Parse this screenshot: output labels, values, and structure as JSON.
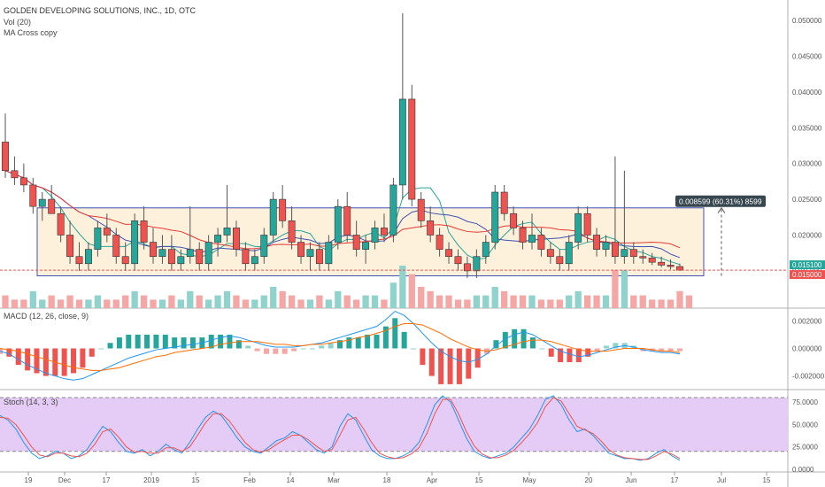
{
  "header": {
    "symbol": "GOLDEN DEVELOPING SOLUTIONS, INC., 1D, OTC",
    "vol_label": "Vol (20)",
    "ma_label": "MA Cross copy",
    "macd_label": "MACD (12, 26, close, 9)",
    "stoch_label": "Stoch (14, 3, 3)"
  },
  "colors": {
    "up": "#26a69a",
    "down": "#ef5350",
    "vol_up": "#8fd3cc",
    "vol_down": "#f4a7a5",
    "box_fill": "#fdf1dc",
    "box_stroke": "#3f51b5",
    "macd_line": "#2196f3",
    "signal_line": "#ff6d00",
    "stoch_bg": "#e5ccf6",
    "price_tag": "#26a69a",
    "price_tag2": "#ef5350",
    "measure_bg": "#37474f"
  },
  "chart_data": [
    {
      "type": "candlestick",
      "title": "GOLDEN DEVELOPING SOLUTIONS, INC., 1D, OTC",
      "x_ticks": [
        "19",
        "Dec",
        "17",
        "2019",
        "15",
        "Feb",
        "14",
        "Mar",
        "18",
        "Apr",
        "15",
        "May",
        "20",
        "Jun",
        "17",
        "Jul",
        "15"
      ],
      "y_ticks": [
        "0.050000",
        "0.045000",
        "0.040000",
        "0.035000",
        "0.030000",
        "0.025000",
        "0.020000",
        "0.015000"
      ],
      "ylim": [
        0.0135,
        0.051
      ],
      "price_tags": [
        "0.015100",
        "0.015000"
      ],
      "measure_label": "0.008599 (60.31%) 8599",
      "range_box": {
        "low": 0.0143,
        "high": 0.0238
      },
      "candles": [
        {
          "o": 0.033,
          "h": 0.037,
          "l": 0.028,
          "c": 0.029
        },
        {
          "o": 0.029,
          "h": 0.031,
          "l": 0.027,
          "c": 0.028
        },
        {
          "o": 0.028,
          "h": 0.03,
          "l": 0.026,
          "c": 0.027
        },
        {
          "o": 0.027,
          "h": 0.028,
          "l": 0.023,
          "c": 0.024
        },
        {
          "o": 0.024,
          "h": 0.026,
          "l": 0.022,
          "c": 0.025
        },
        {
          "o": 0.025,
          "h": 0.027,
          "l": 0.023,
          "c": 0.023
        },
        {
          "o": 0.023,
          "h": 0.024,
          "l": 0.019,
          "c": 0.02
        },
        {
          "o": 0.02,
          "h": 0.022,
          "l": 0.016,
          "c": 0.017
        },
        {
          "o": 0.017,
          "h": 0.019,
          "l": 0.015,
          "c": 0.016
        },
        {
          "o": 0.016,
          "h": 0.019,
          "l": 0.015,
          "c": 0.018
        },
        {
          "o": 0.018,
          "h": 0.022,
          "l": 0.017,
          "c": 0.021
        },
        {
          "o": 0.021,
          "h": 0.023,
          "l": 0.019,
          "c": 0.02
        },
        {
          "o": 0.02,
          "h": 0.021,
          "l": 0.016,
          "c": 0.017
        },
        {
          "o": 0.017,
          "h": 0.019,
          "l": 0.015,
          "c": 0.016
        },
        {
          "o": 0.016,
          "h": 0.023,
          "l": 0.015,
          "c": 0.022
        },
        {
          "o": 0.022,
          "h": 0.024,
          "l": 0.018,
          "c": 0.019
        },
        {
          "o": 0.019,
          "h": 0.021,
          "l": 0.016,
          "c": 0.017
        },
        {
          "o": 0.017,
          "h": 0.02,
          "l": 0.016,
          "c": 0.018
        },
        {
          "o": 0.018,
          "h": 0.02,
          "l": 0.015,
          "c": 0.016
        },
        {
          "o": 0.016,
          "h": 0.018,
          "l": 0.015,
          "c": 0.017
        },
        {
          "o": 0.017,
          "h": 0.024,
          "l": 0.016,
          "c": 0.018
        },
        {
          "o": 0.018,
          "h": 0.019,
          "l": 0.015,
          "c": 0.016
        },
        {
          "o": 0.016,
          "h": 0.02,
          "l": 0.015,
          "c": 0.019
        },
        {
          "o": 0.019,
          "h": 0.021,
          "l": 0.017,
          "c": 0.02
        },
        {
          "o": 0.02,
          "h": 0.027,
          "l": 0.019,
          "c": 0.021
        },
        {
          "o": 0.021,
          "h": 0.022,
          "l": 0.017,
          "c": 0.018
        },
        {
          "o": 0.018,
          "h": 0.019,
          "l": 0.015,
          "c": 0.016
        },
        {
          "o": 0.016,
          "h": 0.018,
          "l": 0.015,
          "c": 0.017
        },
        {
          "o": 0.017,
          "h": 0.021,
          "l": 0.016,
          "c": 0.02
        },
        {
          "o": 0.02,
          "h": 0.026,
          "l": 0.019,
          "c": 0.025
        },
        {
          "o": 0.025,
          "h": 0.027,
          "l": 0.021,
          "c": 0.022
        },
        {
          "o": 0.022,
          "h": 0.024,
          "l": 0.018,
          "c": 0.019
        },
        {
          "o": 0.019,
          "h": 0.02,
          "l": 0.016,
          "c": 0.017
        },
        {
          "o": 0.017,
          "h": 0.019,
          "l": 0.015,
          "c": 0.018
        },
        {
          "o": 0.018,
          "h": 0.019,
          "l": 0.015,
          "c": 0.016
        },
        {
          "o": 0.016,
          "h": 0.02,
          "l": 0.015,
          "c": 0.019
        },
        {
          "o": 0.019,
          "h": 0.025,
          "l": 0.018,
          "c": 0.024
        },
        {
          "o": 0.024,
          "h": 0.026,
          "l": 0.019,
          "c": 0.02
        },
        {
          "o": 0.02,
          "h": 0.022,
          "l": 0.017,
          "c": 0.018
        },
        {
          "o": 0.018,
          "h": 0.02,
          "l": 0.016,
          "c": 0.019
        },
        {
          "o": 0.019,
          "h": 0.022,
          "l": 0.018,
          "c": 0.021
        },
        {
          "o": 0.021,
          "h": 0.023,
          "l": 0.019,
          "c": 0.02
        },
        {
          "o": 0.02,
          "h": 0.028,
          "l": 0.019,
          "c": 0.027
        },
        {
          "o": 0.027,
          "h": 0.051,
          "l": 0.025,
          "c": 0.039
        },
        {
          "o": 0.039,
          "h": 0.041,
          "l": 0.024,
          "c": 0.025
        },
        {
          "o": 0.025,
          "h": 0.026,
          "l": 0.021,
          "c": 0.022
        },
        {
          "o": 0.022,
          "h": 0.024,
          "l": 0.019,
          "c": 0.02
        },
        {
          "o": 0.02,
          "h": 0.021,
          "l": 0.017,
          "c": 0.018
        },
        {
          "o": 0.018,
          "h": 0.019,
          "l": 0.016,
          "c": 0.017
        },
        {
          "o": 0.017,
          "h": 0.018,
          "l": 0.015,
          "c": 0.016
        },
        {
          "o": 0.016,
          "h": 0.017,
          "l": 0.014,
          "c": 0.015
        },
        {
          "o": 0.015,
          "h": 0.018,
          "l": 0.014,
          "c": 0.017
        },
        {
          "o": 0.017,
          "h": 0.02,
          "l": 0.016,
          "c": 0.019
        },
        {
          "o": 0.019,
          "h": 0.027,
          "l": 0.018,
          "c": 0.026
        },
        {
          "o": 0.026,
          "h": 0.027,
          "l": 0.022,
          "c": 0.023
        },
        {
          "o": 0.023,
          "h": 0.024,
          "l": 0.02,
          "c": 0.021
        },
        {
          "o": 0.021,
          "h": 0.022,
          "l": 0.018,
          "c": 0.019
        },
        {
          "o": 0.019,
          "h": 0.023,
          "l": 0.018,
          "c": 0.02
        },
        {
          "o": 0.02,
          "h": 0.021,
          "l": 0.017,
          "c": 0.018
        },
        {
          "o": 0.018,
          "h": 0.019,
          "l": 0.016,
          "c": 0.017
        },
        {
          "o": 0.017,
          "h": 0.018,
          "l": 0.015,
          "c": 0.016
        },
        {
          "o": 0.016,
          "h": 0.02,
          "l": 0.015,
          "c": 0.019
        },
        {
          "o": 0.019,
          "h": 0.024,
          "l": 0.018,
          "c": 0.023
        },
        {
          "o": 0.023,
          "h": 0.024,
          "l": 0.019,
          "c": 0.02
        },
        {
          "o": 0.02,
          "h": 0.021,
          "l": 0.017,
          "c": 0.018
        },
        {
          "o": 0.018,
          "h": 0.02,
          "l": 0.017,
          "c": 0.019
        },
        {
          "o": 0.019,
          "h": 0.031,
          "l": 0.016,
          "c": 0.017
        },
        {
          "o": 0.017,
          "h": 0.029,
          "l": 0.016,
          "c": 0.018
        },
        {
          "o": 0.018,
          "h": 0.019,
          "l": 0.016,
          "c": 0.017
        },
        {
          "o": 0.017,
          "h": 0.018,
          "l": 0.016,
          "c": 0.0168
        },
        {
          "o": 0.0168,
          "h": 0.0175,
          "l": 0.0158,
          "c": 0.0162
        },
        {
          "o": 0.0162,
          "h": 0.017,
          "l": 0.0155,
          "c": 0.0158
        },
        {
          "o": 0.0158,
          "h": 0.0166,
          "l": 0.0152,
          "c": 0.0156
        },
        {
          "o": 0.0156,
          "h": 0.016,
          "l": 0.015,
          "c": 0.0151
        }
      ]
    },
    {
      "type": "bar",
      "title": "Vol (20)",
      "values": [
        3,
        2,
        2,
        4,
        2,
        3,
        2,
        3,
        2,
        2,
        3,
        2,
        2,
        3,
        4,
        3,
        2,
        2,
        3,
        2,
        4,
        3,
        2,
        3,
        4,
        3,
        2,
        2,
        3,
        5,
        4,
        3,
        2,
        2,
        3,
        2,
        4,
        3,
        2,
        3,
        3,
        2,
        6,
        10,
        8,
        5,
        4,
        3,
        3,
        2,
        2,
        3,
        3,
        5,
        4,
        3,
        3,
        3,
        2,
        2,
        2,
        3,
        4,
        3,
        3,
        3,
        9,
        9,
        3,
        3,
        2,
        2,
        2,
        4,
        3
      ],
      "up": [
        0,
        0,
        0,
        1,
        1,
        0,
        0,
        0,
        0,
        1,
        1,
        0,
        0,
        0,
        1,
        0,
        0,
        1,
        0,
        1,
        1,
        0,
        1,
        1,
        1,
        0,
        0,
        1,
        1,
        1,
        0,
        0,
        0,
        1,
        0,
        1,
        1,
        0,
        0,
        1,
        1,
        0,
        1,
        1,
        0,
        0,
        0,
        0,
        0,
        0,
        0,
        1,
        1,
        1,
        0,
        0,
        0,
        1,
        0,
        0,
        0,
        1,
        1,
        0,
        0,
        1,
        0,
        1,
        0,
        0,
        0,
        0,
        0,
        0,
        0
      ]
    },
    {
      "type": "line",
      "title": "MACD (12, 26, close, 9)",
      "y_ticks": [
        "0.002000",
        "0.000000",
        "-0.002000"
      ],
      "ylim": [
        -0.0028,
        0.0028
      ],
      "series": [
        {
          "values": [
            -0.0002,
            -0.0004,
            -0.0008,
            -0.0012,
            -0.0015,
            -0.0018,
            -0.002,
            -0.0022,
            -0.0023,
            -0.0022,
            -0.0019,
            -0.0016,
            -0.0013,
            -0.001,
            -0.0007,
            -0.0005,
            -0.0003,
            -0.0001,
            0.0,
            0.0001,
            0.0002,
            0.0003,
            0.0004,
            0.0006,
            0.0008,
            0.0009,
            0.0008,
            0.0006,
            0.0004,
            0.0002,
            0.0001,
            0.0001,
            0.0001,
            0.0002,
            0.0003,
            0.0004,
            0.0006,
            0.0008,
            0.001,
            0.0012,
            0.0014,
            0.0016,
            0.0021,
            0.0027,
            0.0024,
            0.0018,
            0.0011,
            0.0004,
            -0.0002,
            -0.0006,
            -0.0009,
            -0.001,
            -0.0008,
            -0.0004,
            0.0002,
            0.0007,
            0.001,
            0.0012,
            0.001,
            0.0006,
            0.0002,
            -0.0002,
            -0.0004,
            -0.0006,
            -0.0005,
            -0.0003,
            -0.0001,
            0.0001,
            0.0002,
            0.0001,
            -0.0001,
            -0.0002,
            -0.0003,
            -0.0003,
            -0.0004
          ]
        },
        {
          "values": [
            0.0,
            -0.0001,
            -0.0002,
            -0.0004,
            -0.0006,
            -0.0008,
            -0.001,
            -0.0012,
            -0.0014,
            -0.0015,
            -0.0016,
            -0.0016,
            -0.0015,
            -0.0014,
            -0.0012,
            -0.001,
            -0.0008,
            -0.0006,
            -0.0005,
            -0.0003,
            -0.0002,
            -0.0001,
            0.0,
            0.0001,
            0.0003,
            0.0004,
            0.0005,
            0.0005,
            0.0005,
            0.0004,
            0.0003,
            0.0003,
            0.0002,
            0.0002,
            0.0003,
            0.0003,
            0.0004,
            0.0005,
            0.0006,
            0.0008,
            0.0009,
            0.0011,
            0.0013,
            0.0016,
            0.0018,
            0.0018,
            0.0017,
            0.0014,
            0.0011,
            0.0007,
            0.0004,
            0.0001,
            -0.0001,
            -0.0002,
            -0.0001,
            0.0001,
            0.0003,
            0.0005,
            0.0006,
            0.0006,
            0.0005,
            0.0003,
            0.0001,
            -0.0001,
            -0.0002,
            -0.0002,
            -0.0002,
            -0.0001,
            0.0,
            0.0,
            0.0,
            -0.0001,
            -0.0002,
            -0.0002,
            -0.0003
          ]
        }
      ]
    },
    {
      "type": "line",
      "title": "Stoch (14, 3, 3)",
      "y_ticks": [
        "75.0000",
        "50.0000",
        "25.0000",
        "0.0000"
      ],
      "ylim": [
        0,
        85
      ],
      "series": [
        {
          "values": [
            60,
            55,
            45,
            30,
            18,
            12,
            15,
            20,
            18,
            12,
            15,
            22,
            35,
            48,
            42,
            30,
            20,
            18,
            22,
            15,
            20,
            28,
            22,
            18,
            30,
            45,
            58,
            65,
            60,
            48,
            35,
            25,
            20,
            18,
            25,
            32,
            35,
            42,
            38,
            30,
            22,
            18,
            25,
            48,
            62,
            55,
            38,
            22,
            15,
            12,
            12,
            15,
            20,
            30,
            50,
            72,
            82,
            75,
            55,
            35,
            20,
            15,
            12,
            15,
            18,
            25,
            35,
            45,
            60,
            78,
            82,
            72,
            55,
            42,
            45,
            38,
            28,
            18,
            15,
            12,
            12,
            10,
            12,
            18,
            22,
            15,
            10
          ]
        },
        {
          "values": [
            58,
            57,
            50,
            38,
            25,
            16,
            14,
            18,
            18,
            15,
            14,
            18,
            28,
            42,
            45,
            36,
            25,
            19,
            20,
            18,
            18,
            24,
            24,
            20,
            25,
            38,
            52,
            62,
            62,
            54,
            42,
            30,
            22,
            19,
            22,
            28,
            33,
            38,
            38,
            33,
            26,
            20,
            22,
            38,
            55,
            58,
            45,
            30,
            18,
            14,
            12,
            13,
            17,
            24,
            40,
            62,
            78,
            78,
            62,
            42,
            26,
            17,
            13,
            13,
            16,
            21,
            30,
            40,
            52,
            70,
            80,
            76,
            62,
            48,
            44,
            40,
            32,
            22,
            16,
            13,
            12,
            11,
            11,
            15,
            20,
            17,
            12
          ]
        }
      ]
    }
  ]
}
